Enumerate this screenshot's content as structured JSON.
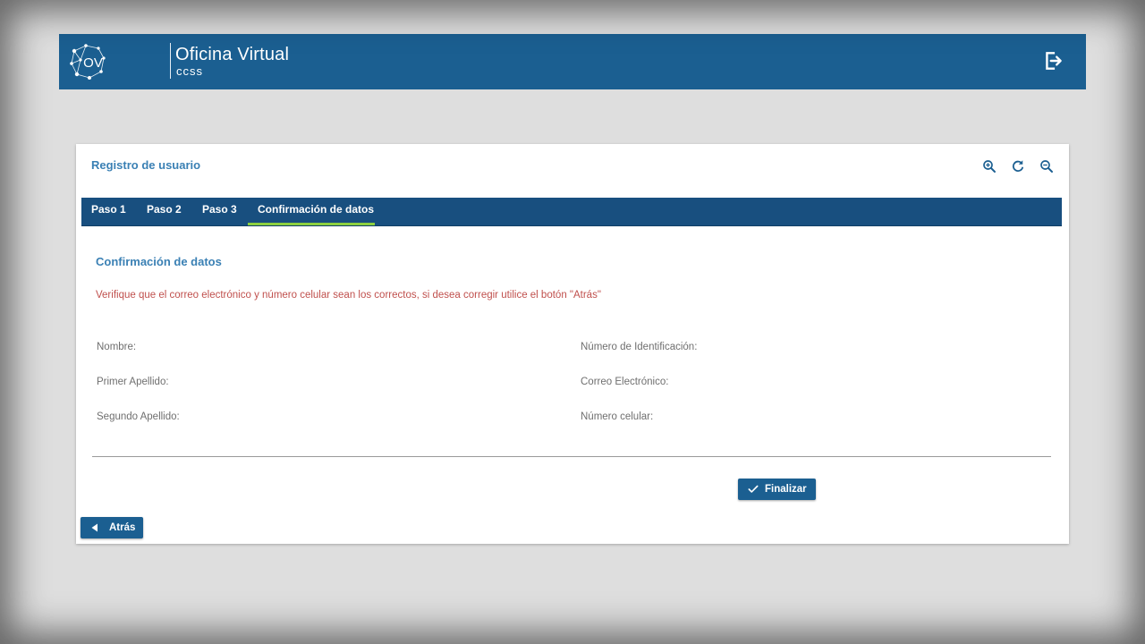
{
  "header": {
    "logo_initials": "OV",
    "logo_title": "Oficina Virtual",
    "logo_subtitle": "ccss",
    "logout_icon": "logout-icon"
  },
  "card": {
    "title": "Registro de usuario",
    "toolbar": [
      {
        "icon": "zoom-in-icon"
      },
      {
        "icon": "refresh-icon"
      },
      {
        "icon": "zoom-out-icon"
      }
    ]
  },
  "tabs": [
    {
      "label": "Paso 1",
      "active": false
    },
    {
      "label": "Paso 2",
      "active": false
    },
    {
      "label": "Paso 3",
      "active": false
    },
    {
      "label": "Confirmación de datos",
      "active": true
    }
  ],
  "main": {
    "section_title": "Confirmación de datos",
    "warning": "Verifique que el correo electrónico y número celular sean los correctos, si desea corregir utilice el botón \"Atrás\"",
    "fields_left": [
      {
        "label": "Nombre:"
      },
      {
        "label": "Primer Apellido:"
      },
      {
        "label": "Segundo Apellido:"
      }
    ],
    "fields_right": [
      {
        "label": "Número de Identificación:"
      },
      {
        "label": "Correo Electrónico:"
      },
      {
        "label": "Número celular:"
      }
    ]
  },
  "buttons": {
    "finalize_label": "Finalizar",
    "back_label": "Atrás"
  },
  "colors": {
    "primary": "#1b5f91",
    "tab_bar": "#184f7f",
    "active_tab_underline": "#8ccf3f",
    "title_blue": "#3a80b4",
    "warning_red": "#c0504d",
    "background": "#dedede"
  }
}
